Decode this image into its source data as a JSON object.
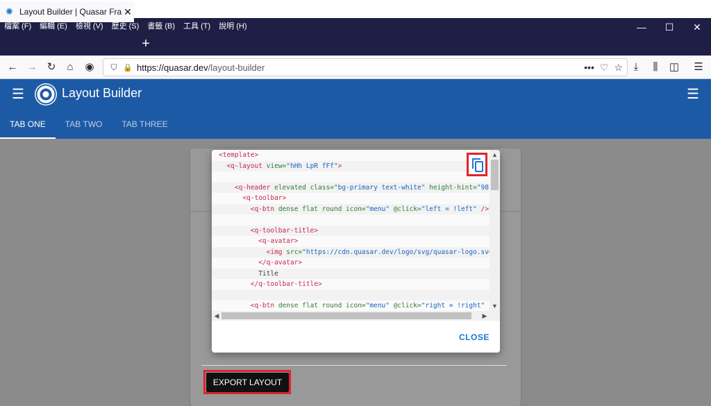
{
  "browser": {
    "menu": [
      "檔案 (F)",
      "編輯 (E)",
      "檢視 (V)",
      "歷史 (S)",
      "書籤 (B)",
      "工具 (T)",
      "說明 (H)"
    ],
    "tab_title": "Layout Builder | Quasar Frame",
    "new_tab_symbol": "+",
    "url_host": "https://quasar.dev",
    "url_path": "/layout-builder",
    "window_controls": [
      "—",
      "☐",
      "✕"
    ]
  },
  "app": {
    "title": "Layout Builder",
    "tabs": [
      "TAB ONE",
      "TAB TWO",
      "TAB THREE"
    ],
    "active_tab": "TAB ONE",
    "accent_color": "#1d5aa6"
  },
  "dialog": {
    "code_lines": [
      [
        [
          "t",
          "<template>"
        ]
      ],
      [
        [
          "p",
          "  "
        ],
        [
          "t",
          "<q-layout "
        ],
        [
          "a",
          "view="
        ],
        [
          "s",
          "\"hHh LpR fFf\""
        ],
        [
          "t",
          ">"
        ]
      ],
      [],
      [
        [
          "p",
          "    "
        ],
        [
          "t",
          "<q-header "
        ],
        [
          "a",
          "elevated class="
        ],
        [
          "s",
          "\"bg-primary text-white\""
        ],
        [
          "a",
          " height-hint="
        ],
        [
          "s",
          "\"98\""
        ],
        [
          "t",
          ">"
        ]
      ],
      [
        [
          "p",
          "      "
        ],
        [
          "t",
          "<q-toolbar>"
        ]
      ],
      [
        [
          "p",
          "        "
        ],
        [
          "t",
          "<q-btn "
        ],
        [
          "a",
          "dense flat round icon="
        ],
        [
          "s",
          "\"menu\""
        ],
        [
          "a",
          " @click="
        ],
        [
          "s",
          "\"left = !left\""
        ],
        [
          "t",
          " />"
        ]
      ],
      [],
      [
        [
          "p",
          "        "
        ],
        [
          "t",
          "<q-toolbar-title>"
        ]
      ],
      [
        [
          "p",
          "          "
        ],
        [
          "t",
          "<q-avatar>"
        ]
      ],
      [
        [
          "p",
          "            "
        ],
        [
          "t",
          "<img "
        ],
        [
          "a",
          "src="
        ],
        [
          "s",
          "\"https://cdn.quasar.dev/logo/svg/quasar-logo.svg\""
        ]
      ],
      [
        [
          "p",
          "          "
        ],
        [
          "t",
          "</q-avatar>"
        ]
      ],
      [
        [
          "p",
          "          Title"
        ]
      ],
      [
        [
          "p",
          "        "
        ],
        [
          "t",
          "</q-toolbar-title>"
        ]
      ],
      [],
      [
        [
          "p",
          "        "
        ],
        [
          "t",
          "<q-btn "
        ],
        [
          "a",
          "dense flat round icon="
        ],
        [
          "s",
          "\"menu\""
        ],
        [
          "a",
          " @click="
        ],
        [
          "s",
          "\"right = !right\""
        ]
      ]
    ],
    "close_label": "CLOSE"
  },
  "page": {
    "export_label": "EXPORT LAYOUT"
  }
}
